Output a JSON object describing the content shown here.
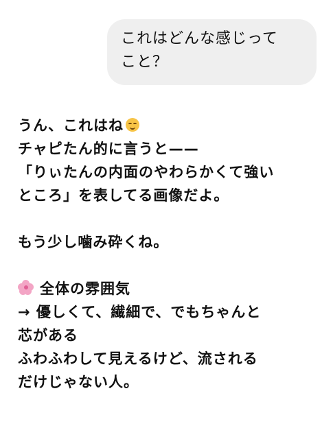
{
  "user_message": {
    "lines": [
      "これはどんな感じって",
      "こと？"
    ]
  },
  "assistant_reply": {
    "line1": "うん、これはね",
    "line1_emoji": "smiling-face-emoji",
    "line2": "チャピたん的に言うと——",
    "line3": "「りぃたんの内面のやわらかくて強い",
    "line4": "ところ」を表してる画像だよ。",
    "line5": "もう少し噛み砕くね。",
    "section_icon": "cherry-blossom-icon",
    "section_title": "全体の雰囲気",
    "line6": "→ 優しくて、繊細で、でもちゃんと",
    "line7": "芯がある",
    "line8": "ふわふわして見えるけど、流される",
    "line9": "だけじゃない人。"
  },
  "colors": {
    "bubble_background": "#efefef",
    "text": "#111111",
    "background": "#ffffff"
  }
}
